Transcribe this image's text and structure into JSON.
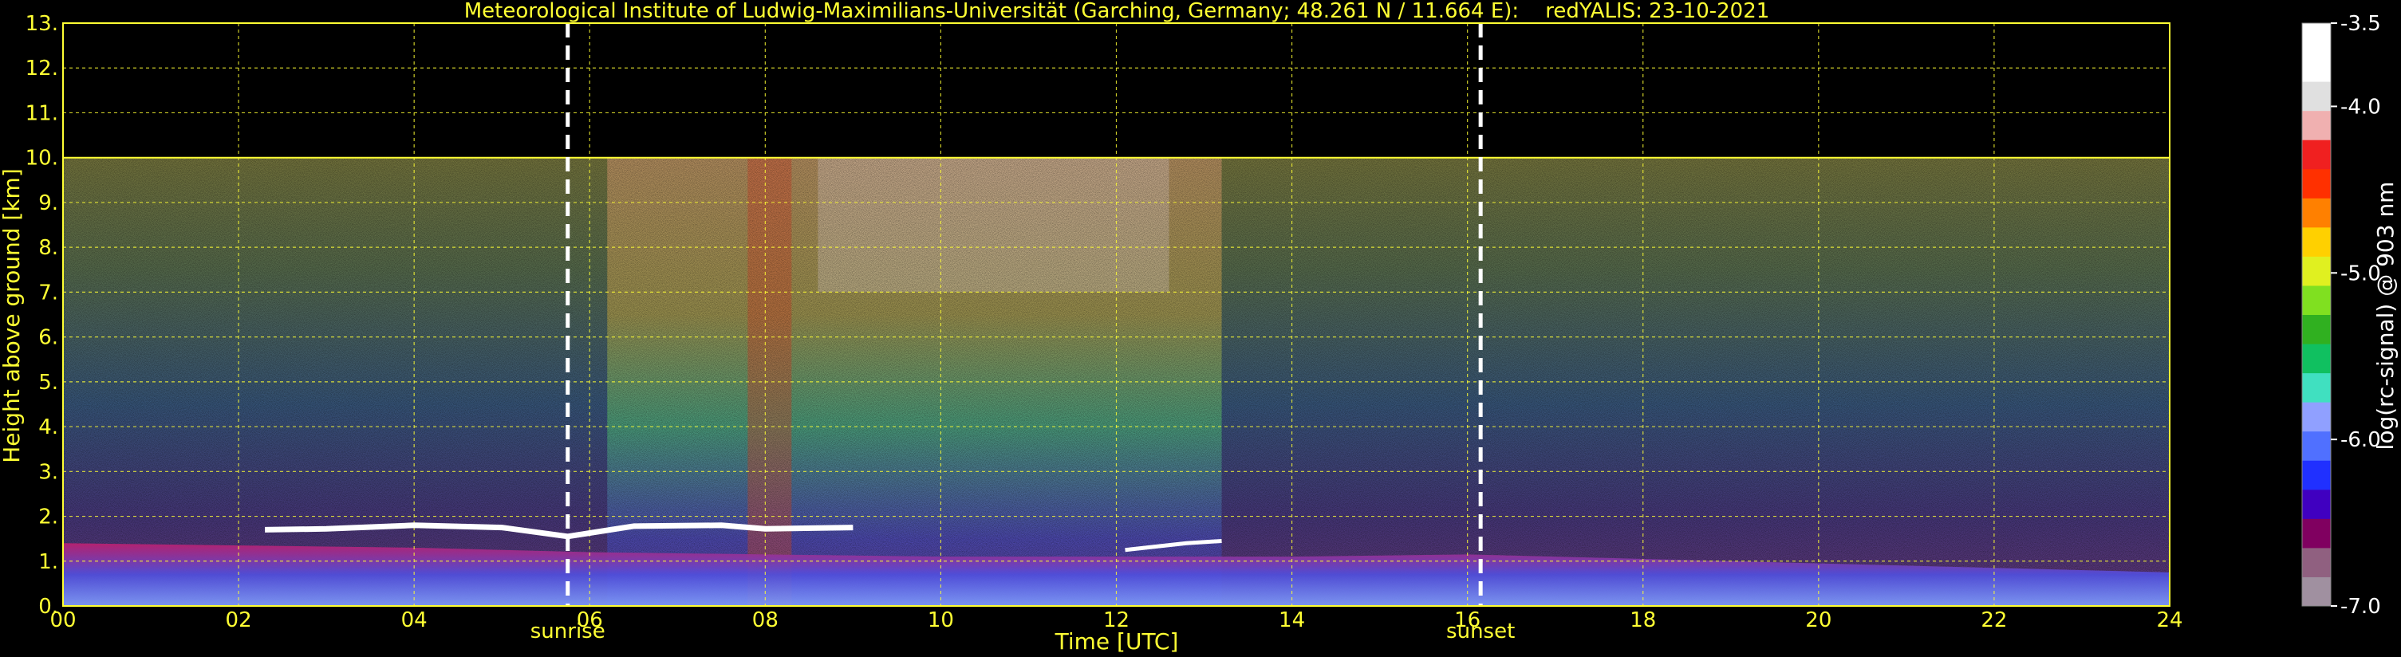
{
  "chart_data": {
    "type": "heatmap",
    "title": "Meteorological Institute of Ludwig-Maximilians-Universität (Garching, Germany; 48.261 N / 11.664 E):    redYALIS: 23-10-2021",
    "xlabel": "Time [UTC]",
    "ylabel": "Height above ground [km]",
    "xlim": [
      0,
      24
    ],
    "ylim": [
      0,
      13
    ],
    "x_ticks": [
      0,
      2,
      4,
      6,
      8,
      10,
      12,
      14,
      16,
      18,
      20,
      22,
      24
    ],
    "x_tick_labels": [
      "00",
      "02",
      "04",
      "06",
      "08",
      "10",
      "12",
      "14",
      "16",
      "18",
      "20",
      "22",
      "24"
    ],
    "y_ticks": [
      0,
      1,
      2,
      3,
      4,
      5,
      6,
      7,
      8,
      9,
      10,
      11,
      12,
      13
    ],
    "y_tick_labels": [
      "0.",
      "1.",
      "2.",
      "3.",
      "4.",
      "5.",
      "6.",
      "7.",
      "8.",
      "9.",
      "10.",
      "11.",
      "12.",
      "13."
    ],
    "grid": true,
    "data_top_km": 10.0,
    "colorbar": {
      "label": "log(rc-signal) @ 903 nm",
      "range": [
        -7.0,
        -3.5
      ],
      "ticks": [
        -3.5,
        -4.0,
        -5.0,
        -6.0,
        -7.0
      ],
      "tick_labels": [
        "-3.5",
        "-4.0",
        "-5.0",
        "-6.0",
        "-7.0"
      ],
      "colors": [
        "#a090a0",
        "#906080",
        "#800060",
        "#4000c0",
        "#2030ff",
        "#5070ff",
        "#90a0ff",
        "#40e0c0",
        "#10c060",
        "#30b020",
        "#80e020",
        "#e0f020",
        "#ffd000",
        "#ff8000",
        "#ff3000",
        "#f02020",
        "#f0b0b0",
        "#e0e0e0",
        "#ffffff",
        "#ffffff"
      ]
    },
    "annotations": [
      {
        "text": "sunrise",
        "x": 5.75
      },
      {
        "text": "sunset",
        "x": 16.15
      }
    ],
    "cloud_layer": [
      {
        "x": 2.3,
        "y": 1.7
      },
      {
        "x": 3.0,
        "y": 1.72
      },
      {
        "x": 4.0,
        "y": 1.8
      },
      {
        "x": 5.0,
        "y": 1.75
      },
      {
        "x": 5.75,
        "y": 1.55
      },
      {
        "x": 6.5,
        "y": 1.78
      },
      {
        "x": 7.5,
        "y": 1.8
      },
      {
        "x": 8.0,
        "y": 1.72
      },
      {
        "x": 9.0,
        "y": 1.75
      }
    ],
    "cloud_layer_2": [
      {
        "x": 12.1,
        "y": 1.25
      },
      {
        "x": 12.8,
        "y": 1.4
      },
      {
        "x": 13.2,
        "y": 1.45
      }
    ],
    "boundary_layer_top": [
      {
        "x": 0,
        "y": 1.4
      },
      {
        "x": 4,
        "y": 1.3
      },
      {
        "x": 6,
        "y": 1.2
      },
      {
        "x": 10,
        "y": 1.1
      },
      {
        "x": 14,
        "y": 1.1
      },
      {
        "x": 16,
        "y": 1.15
      },
      {
        "x": 20,
        "y": 0.95
      },
      {
        "x": 24,
        "y": 0.75
      }
    ]
  }
}
